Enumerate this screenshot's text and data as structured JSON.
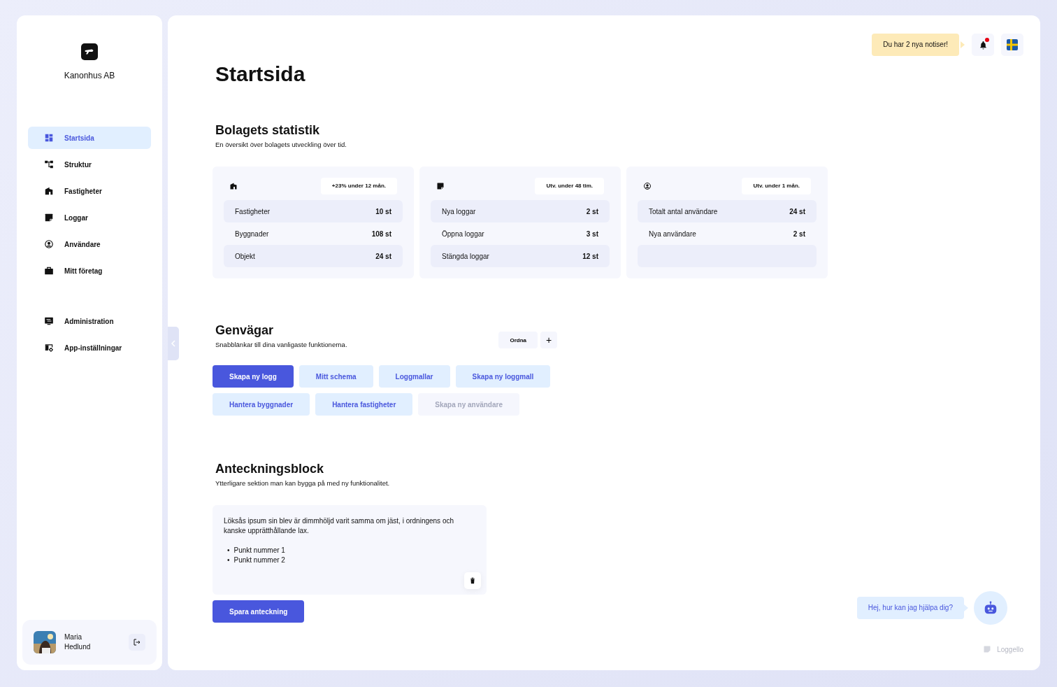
{
  "company": {
    "name": "Kanonhus AB"
  },
  "nav": {
    "main": [
      {
        "label": "Startsida",
        "selected": true
      },
      {
        "label": "Struktur",
        "selected": false
      },
      {
        "label": "Fastigheter",
        "selected": false
      },
      {
        "label": "Loggar",
        "selected": false
      },
      {
        "label": "Användare",
        "selected": false
      },
      {
        "label": "Mitt företag",
        "selected": false
      }
    ],
    "admin": [
      {
        "label": "Administration",
        "selected": false
      },
      {
        "label": "App-inställningar",
        "selected": false
      }
    ]
  },
  "user": {
    "name_lines": [
      "Maria",
      "Hedlund"
    ]
  },
  "topbar": {
    "notice": "Du har 2 nya notiser!",
    "unread": true
  },
  "page_title": "Startsida",
  "stats": {
    "title": "Bolagets statistik",
    "subtitle": "En översikt över bolagets utveckling över tid.",
    "cards": [
      {
        "badge": "+23% under 12 mån.",
        "rows": [
          {
            "label": "Fastigheter",
            "value": "10 st"
          },
          {
            "label": "Byggnader",
            "value": "108 st"
          },
          {
            "label": "Objekt",
            "value": "24 st"
          }
        ]
      },
      {
        "badge": "Utv. under 48 tim.",
        "rows": [
          {
            "label": "Nya loggar",
            "value": "2 st"
          },
          {
            "label": "Öppna loggar",
            "value": "3 st"
          },
          {
            "label": "Stängda loggar",
            "value": "12 st"
          }
        ]
      },
      {
        "badge": "Utv. under 1 mån.",
        "rows": [
          {
            "label": "Totalt antal användare",
            "value": "24 st"
          },
          {
            "label": "Nya användare",
            "value": "2 st"
          }
        ]
      }
    ]
  },
  "shortcuts": {
    "title": "Genvägar",
    "subtitle": "Snabblänkar till dina vanligaste funktionerna.",
    "order_button": "Ordna",
    "add_button": "+",
    "buttons": [
      {
        "label": "Skapa ny logg",
        "kind": "primary",
        "disabled": false
      },
      {
        "label": "Mitt schema",
        "kind": "secondary",
        "disabled": false
      },
      {
        "label": "Loggmallar",
        "kind": "secondary",
        "disabled": false
      },
      {
        "label": "Skapa ny loggmall",
        "kind": "secondary",
        "disabled": false
      },
      {
        "label": "Hantera byggnader",
        "kind": "secondary",
        "disabled": false
      },
      {
        "label": "Hantera fastigheter",
        "kind": "secondary",
        "disabled": false
      },
      {
        "label": "Skapa ny användare",
        "kind": "secondary",
        "disabled": true
      }
    ]
  },
  "notes": {
    "title": "Anteckningsblock",
    "subtitle": "Ytterligare sektion man kan bygga på med ny funktionalitet.",
    "text": "Löksås ipsum sin blev är dimmhöljd varit samma om jäst, i ordningens och kanske upprätthållande lax.",
    "bullet_marker": "•",
    "bullets": [
      "Punkt nummer 1",
      "Punkt nummer 2"
    ],
    "save_button": "Spara anteckning"
  },
  "chat": {
    "message": "Hej, hur kan jag hjälpa dig?"
  },
  "footer": {
    "brand": "Loggello"
  }
}
